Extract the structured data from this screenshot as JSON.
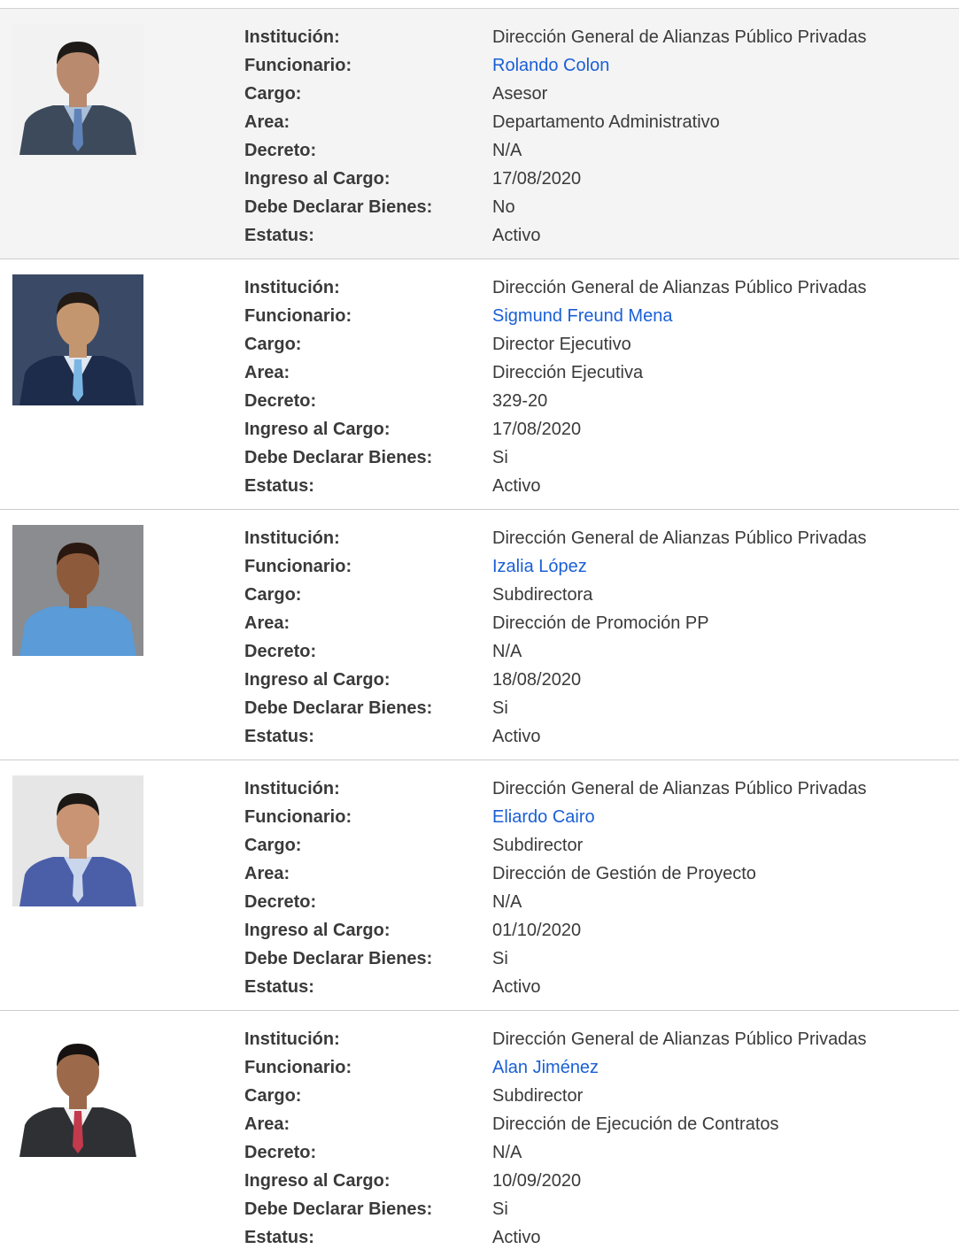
{
  "labels": {
    "institucion": "Institución:",
    "funcionario": "Funcionario:",
    "cargo": "Cargo:",
    "area": "Area:",
    "decreto": "Decreto:",
    "ingreso": "Ingreso al Cargo:",
    "declarar": "Debe Declarar Bienes:",
    "estatus": "Estatus:"
  },
  "records": [
    {
      "institucion": "Dirección General de Alianzas Público Privadas",
      "funcionario": "Rolando Colon",
      "cargo": "Asesor",
      "area": "Departamento Administrativo",
      "decreto": "N/A",
      "ingreso": "17/08/2020",
      "declarar": "No",
      "estatus": "Activo",
      "photo": {
        "bg": "#f2f2f2",
        "suit": "#3d4a5c",
        "shirt": "#a9bfd9",
        "tie": "#5f83b8",
        "skin": "#b98a6e",
        "hair": "#1e1a18"
      }
    },
    {
      "institucion": "Dirección General de Alianzas Público Privadas",
      "funcionario": "Sigmund Freund Mena",
      "cargo": "Director Ejecutivo",
      "area": "Dirección Ejecutiva",
      "decreto": "329-20",
      "ingreso": "17/08/2020",
      "declarar": "Si",
      "estatus": "Activo",
      "photo": {
        "bg": "#3a4a66",
        "suit": "#1d2c4a",
        "shirt": "#dfe8f2",
        "tie": "#79b6e3",
        "skin": "#c4966f",
        "hair": "#221a15"
      }
    },
    {
      "institucion": "Dirección General de Alianzas Público Privadas",
      "funcionario": "Izalia López",
      "cargo": "Subdirectora",
      "area": "Dirección de Promoción PP",
      "decreto": "N/A",
      "ingreso": "18/08/2020",
      "declarar": "Si",
      "estatus": "Activo",
      "photo": {
        "bg": "#8a8c8f",
        "suit": "#5a9bd8",
        "shirt": "#5a9bd8",
        "tie": "#5a9bd8",
        "skin": "#8e5a3c",
        "hair": "#2a1810"
      }
    },
    {
      "institucion": "Dirección General de Alianzas Público Privadas",
      "funcionario": "Eliardo Cairo",
      "cargo": "Subdirector",
      "area": "Dirección de Gestión de Proyecto",
      "decreto": "N/A",
      "ingreso": "01/10/2020",
      "declarar": "Si",
      "estatus": "Activo",
      "photo": {
        "bg": "#e6e6e6",
        "suit": "#4a5fa8",
        "shirt": "#c9d6ec",
        "tie": "#c9d6ec",
        "skin": "#c89474",
        "hair": "#1c1816"
      }
    },
    {
      "institucion": "Dirección General de Alianzas Público Privadas",
      "funcionario": "Alan Jiménez",
      "cargo": "Subdirector",
      "area": "Dirección de Ejecución de Contratos",
      "decreto": "N/A",
      "ingreso": "10/09/2020",
      "declarar": "Si",
      "estatus": "Activo",
      "photo": {
        "bg": "#ffffff",
        "suit": "#2e3034",
        "shirt": "#f2f2f2",
        "tie": "#c23a4b",
        "skin": "#9c6a4a",
        "hair": "#141110"
      }
    }
  ],
  "colors": {
    "link": "#1a5fd6",
    "text": "#3a3a3a",
    "alt_row_bg": "#f4f4f4"
  }
}
